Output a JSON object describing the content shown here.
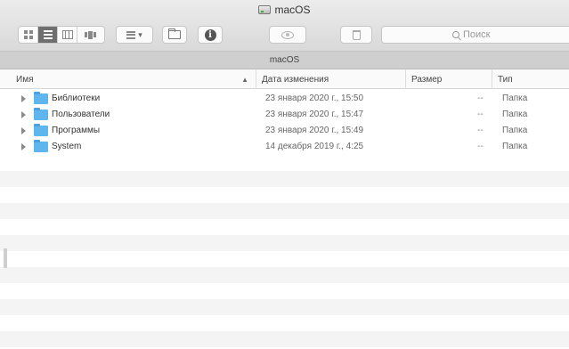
{
  "window": {
    "title": "macOS"
  },
  "toolbar": {
    "view_modes": [
      "icons-view",
      "list-view",
      "columns-view",
      "gallery-view"
    ],
    "active_view": "list-view",
    "search_placeholder": "Поиск"
  },
  "pathbar": {
    "label": "macOS"
  },
  "columns": {
    "name": "Имя",
    "date": "Дата изменения",
    "size": "Размер",
    "kind": "Тип"
  },
  "rows": [
    {
      "name": "Библиотеки",
      "date": "23 января 2020 г., 15:50",
      "size": "--",
      "kind": "Папка"
    },
    {
      "name": "Пользователи",
      "date": "23 января 2020 г., 15:47",
      "size": "--",
      "kind": "Папка"
    },
    {
      "name": "Программы",
      "date": "23 января 2020 г., 15:49",
      "size": "--",
      "kind": "Папка"
    },
    {
      "name": "System",
      "date": "14 декабря 2019 г., 4:25",
      "size": "--",
      "kind": "Папка"
    }
  ],
  "colors": {
    "folder": "#5fb5ee",
    "stripe": "#f4f4f4",
    "toolbar": "#d9d9d9"
  }
}
